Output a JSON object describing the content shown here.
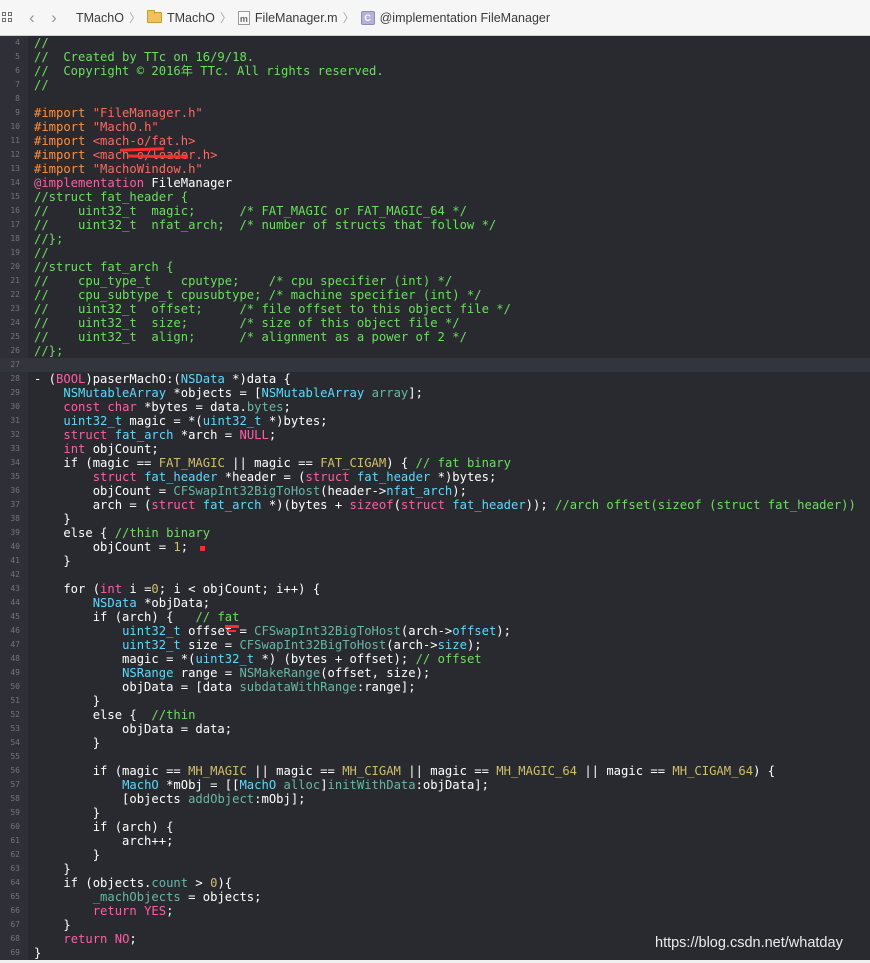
{
  "jumpbar": {
    "icons": [
      "grid-icon",
      "back-chevron-icon",
      "forward-chevron-icon",
      "folder-icon",
      "folder-icon",
      "file-m-icon",
      "implementation-c-icon"
    ],
    "back_glyph": "‹",
    "forward_glyph": "›",
    "crumbs": [
      {
        "label": "TMachO",
        "icon": "none"
      },
      {
        "label": "TMachO",
        "icon": "folder-icon"
      },
      {
        "label": "FileManager.m",
        "icon": "file-m-icon"
      },
      {
        "label": "@implementation FileManager",
        "icon": "implementation-c-icon"
      }
    ],
    "file_icon_letter": "m",
    "impl_icon_letter": "C"
  },
  "colors": {
    "background": "#292a30",
    "comment": "#6bdf5e",
    "preprocessor": "#fd8f3f",
    "string": "#fc6a5d",
    "keyword": "#fc5fa3",
    "type": "#5dd8ff",
    "function": "#67b7a4",
    "macro": "#d0bf69",
    "annotation": "#ff2a2a"
  },
  "code": {
    "current_line": 27,
    "lines": [
      {
        "n": "4",
        "segs": [
          [
            "c",
            "//"
          ]
        ]
      },
      {
        "n": "5",
        "segs": [
          [
            "c",
            "//  Created by TTc on 16/9/18."
          ]
        ]
      },
      {
        "n": "6",
        "segs": [
          [
            "c",
            "//  Copyright © 2016年 TTc. All rights reserved."
          ]
        ]
      },
      {
        "n": "7",
        "segs": [
          [
            "c",
            "//"
          ]
        ]
      },
      {
        "n": "8",
        "segs": []
      },
      {
        "n": "9",
        "segs": [
          [
            "pp",
            "#import "
          ],
          [
            "s",
            "\"FileManager.h\""
          ]
        ]
      },
      {
        "n": "10",
        "segs": [
          [
            "pp",
            "#import "
          ],
          [
            "s",
            "\"MachO.h\""
          ]
        ]
      },
      {
        "n": "11",
        "segs": [
          [
            "pp",
            "#import "
          ],
          [
            "s",
            "<mach-o/fat.h>"
          ]
        ]
      },
      {
        "n": "12",
        "segs": [
          [
            "pp",
            "#import "
          ],
          [
            "s",
            "<mach-o/loader.h>"
          ]
        ]
      },
      {
        "n": "13",
        "segs": [
          [
            "pp",
            "#import "
          ],
          [
            "s",
            "\"MachoWindow.h\""
          ]
        ]
      },
      {
        "n": "14",
        "segs": [
          [
            "k",
            "@implementation"
          ],
          [
            "p",
            " FileManager"
          ]
        ]
      },
      {
        "n": "15",
        "segs": [
          [
            "c",
            "//struct fat_header {"
          ]
        ]
      },
      {
        "n": "16",
        "segs": [
          [
            "c",
            "//    uint32_t  magic;      /* FAT_MAGIC or FAT_MAGIC_64 */"
          ]
        ]
      },
      {
        "n": "17",
        "segs": [
          [
            "c",
            "//    uint32_t  nfat_arch;  /* number of structs that follow */"
          ]
        ]
      },
      {
        "n": "18",
        "segs": [
          [
            "c",
            "//};"
          ]
        ]
      },
      {
        "n": "19",
        "segs": [
          [
            "c",
            "//"
          ]
        ]
      },
      {
        "n": "20",
        "segs": [
          [
            "c",
            "//struct fat_arch {"
          ]
        ]
      },
      {
        "n": "21",
        "segs": [
          [
            "c",
            "//    cpu_type_t    cputype;    /* cpu specifier (int) */"
          ]
        ]
      },
      {
        "n": "22",
        "segs": [
          [
            "c",
            "//    cpu_subtype_t cpusubtype; /* machine specifier (int) */"
          ]
        ]
      },
      {
        "n": "23",
        "segs": [
          [
            "c",
            "//    uint32_t  offset;     /* file offset to this object file */"
          ]
        ]
      },
      {
        "n": "24",
        "segs": [
          [
            "c",
            "//    uint32_t  size;       /* size of this object file */"
          ]
        ]
      },
      {
        "n": "25",
        "segs": [
          [
            "c",
            "//    uint32_t  align;      /* alignment as a power of 2 */"
          ]
        ]
      },
      {
        "n": "26",
        "segs": [
          [
            "c",
            "//};"
          ]
        ]
      },
      {
        "n": "27",
        "segs": []
      },
      {
        "n": "28",
        "segs": [
          [
            "p",
            "- ("
          ],
          [
            "k",
            "BOOL"
          ],
          [
            "p",
            ")paserMachO:("
          ],
          [
            "t",
            "NSData"
          ],
          [
            "p",
            " *)data {"
          ]
        ]
      },
      {
        "n": "29",
        "segs": [
          [
            "p",
            "    "
          ],
          [
            "t",
            "NSMutableArray"
          ],
          [
            "p",
            " *objects = ["
          ],
          [
            "t",
            "NSMutableArray"
          ],
          [
            "p",
            " "
          ],
          [
            "f",
            "array"
          ],
          [
            "p",
            "];"
          ]
        ]
      },
      {
        "n": "30",
        "segs": [
          [
            "p",
            "    "
          ],
          [
            "k",
            "const"
          ],
          [
            "p",
            " "
          ],
          [
            "k",
            "char"
          ],
          [
            "p",
            " *bytes = data."
          ],
          [
            "f",
            "bytes"
          ],
          [
            "p",
            ";"
          ]
        ]
      },
      {
        "n": "31",
        "segs": [
          [
            "p",
            "    "
          ],
          [
            "t",
            "uint32_t"
          ],
          [
            "p",
            " magic = *("
          ],
          [
            "t",
            "uint32_t"
          ],
          [
            "p",
            " *)bytes;"
          ]
        ]
      },
      {
        "n": "32",
        "segs": [
          [
            "p",
            "    "
          ],
          [
            "k",
            "struct"
          ],
          [
            "p",
            " "
          ],
          [
            "t",
            "fat_arch"
          ],
          [
            "p",
            " *arch = "
          ],
          [
            "k",
            "NULL"
          ],
          [
            "p",
            ";"
          ]
        ]
      },
      {
        "n": "33",
        "segs": [
          [
            "p",
            "    "
          ],
          [
            "k",
            "int"
          ],
          [
            "p",
            " objCount;"
          ]
        ]
      },
      {
        "n": "34",
        "segs": [
          [
            "p",
            "    if (magic == "
          ],
          [
            "m",
            "FAT_MAGIC"
          ],
          [
            "p",
            " || magic == "
          ],
          [
            "m",
            "FAT_CIGAM"
          ],
          [
            "p",
            ") { "
          ],
          [
            "c",
            "// fat binary"
          ]
        ]
      },
      {
        "n": "35",
        "segs": [
          [
            "p",
            "        "
          ],
          [
            "k",
            "struct"
          ],
          [
            "p",
            " "
          ],
          [
            "t",
            "fat_header"
          ],
          [
            "p",
            " *header = ("
          ],
          [
            "k",
            "struct"
          ],
          [
            "p",
            " "
          ],
          [
            "t",
            "fat_header"
          ],
          [
            "p",
            " *)bytes;"
          ]
        ]
      },
      {
        "n": "36",
        "segs": [
          [
            "p",
            "        objCount = "
          ],
          [
            "f",
            "CFSwapInt32BigToHost"
          ],
          [
            "p",
            "(header->"
          ],
          [
            "t",
            "nfat_arch"
          ],
          [
            "p",
            ");"
          ]
        ]
      },
      {
        "n": "37",
        "segs": [
          [
            "p",
            "        arch = ("
          ],
          [
            "k",
            "struct"
          ],
          [
            "p",
            " "
          ],
          [
            "t",
            "fat_arch"
          ],
          [
            "p",
            " *)(bytes + "
          ],
          [
            "k",
            "sizeof"
          ],
          [
            "p",
            "("
          ],
          [
            "k",
            "struct"
          ],
          [
            "p",
            " "
          ],
          [
            "t",
            "fat_header"
          ],
          [
            "p",
            "));"
          ],
          [
            "c",
            " //arch offset(sizeof (struct fat_header))"
          ]
        ]
      },
      {
        "n": "38",
        "segs": [
          [
            "p",
            "    }"
          ]
        ]
      },
      {
        "n": "39",
        "segs": [
          [
            "p",
            "    else { "
          ],
          [
            "c",
            "//thin binary"
          ]
        ]
      },
      {
        "n": "40",
        "segs": [
          [
            "p",
            "        objCount = "
          ],
          [
            "n",
            "1"
          ],
          [
            "p",
            ";"
          ]
        ]
      },
      {
        "n": "41",
        "segs": [
          [
            "p",
            "    }"
          ]
        ]
      },
      {
        "n": "42",
        "segs": []
      },
      {
        "n": "43",
        "segs": [
          [
            "p",
            "    for ("
          ],
          [
            "k",
            "int"
          ],
          [
            "p",
            " i ="
          ],
          [
            "n",
            "0"
          ],
          [
            "p",
            "; i < objCount; i++) {"
          ]
        ]
      },
      {
        "n": "44",
        "segs": [
          [
            "p",
            "        "
          ],
          [
            "t",
            "NSData"
          ],
          [
            "p",
            " *objData;"
          ]
        ]
      },
      {
        "n": "45",
        "segs": [
          [
            "p",
            "        if (arch) {   "
          ],
          [
            "c",
            "// fat"
          ]
        ]
      },
      {
        "n": "46",
        "segs": [
          [
            "p",
            "            "
          ],
          [
            "t",
            "uint32_t"
          ],
          [
            "p",
            " offset = "
          ],
          [
            "f",
            "CFSwapInt32BigToHost"
          ],
          [
            "p",
            "(arch->"
          ],
          [
            "t",
            "offset"
          ],
          [
            "p",
            ");"
          ]
        ]
      },
      {
        "n": "47",
        "segs": [
          [
            "p",
            "            "
          ],
          [
            "t",
            "uint32_t"
          ],
          [
            "p",
            " size = "
          ],
          [
            "f",
            "CFSwapInt32BigToHost"
          ],
          [
            "p",
            "(arch->"
          ],
          [
            "t",
            "size"
          ],
          [
            "p",
            ");"
          ]
        ]
      },
      {
        "n": "48",
        "segs": [
          [
            "p",
            "            magic = *("
          ],
          [
            "t",
            "uint32_t"
          ],
          [
            "p",
            " *) (bytes + offset); "
          ],
          [
            "c",
            "// offset"
          ]
        ]
      },
      {
        "n": "49",
        "segs": [
          [
            "p",
            "            "
          ],
          [
            "t",
            "NSRange"
          ],
          [
            "p",
            " range = "
          ],
          [
            "f",
            "NSMakeRange"
          ],
          [
            "p",
            "(offset, size);"
          ]
        ]
      },
      {
        "n": "50",
        "segs": [
          [
            "p",
            "            objData = [data "
          ],
          [
            "f",
            "subdataWithRange"
          ],
          [
            "p",
            ":range];"
          ]
        ]
      },
      {
        "n": "51",
        "segs": [
          [
            "p",
            "        }"
          ]
        ]
      },
      {
        "n": "52",
        "segs": [
          [
            "p",
            "        else {  "
          ],
          [
            "c",
            "//thin"
          ]
        ]
      },
      {
        "n": "53",
        "segs": [
          [
            "p",
            "            objData = data;"
          ]
        ]
      },
      {
        "n": "54",
        "segs": [
          [
            "p",
            "        }"
          ]
        ]
      },
      {
        "n": "55",
        "segs": []
      },
      {
        "n": "56",
        "segs": [
          [
            "p",
            "        if (magic == "
          ],
          [
            "m",
            "MH_MAGIC"
          ],
          [
            "p",
            " || magic == "
          ],
          [
            "m",
            "MH_CIGAM"
          ],
          [
            "p",
            " || magic == "
          ],
          [
            "m",
            "MH_MAGIC_64"
          ],
          [
            "p",
            " || magic == "
          ],
          [
            "m",
            "MH_CIGAM_64"
          ],
          [
            "p",
            ") {"
          ]
        ]
      },
      {
        "n": "57",
        "segs": [
          [
            "p",
            "            "
          ],
          [
            "t",
            "MachO"
          ],
          [
            "p",
            " *mObj = [["
          ],
          [
            "t",
            "MachO"
          ],
          [
            "p",
            " "
          ],
          [
            "f",
            "alloc"
          ],
          [
            "p",
            "]"
          ],
          [
            "f",
            "initWithData"
          ],
          [
            "p",
            ":objData];"
          ]
        ]
      },
      {
        "n": "58",
        "segs": [
          [
            "p",
            "            [objects "
          ],
          [
            "f",
            "addObject"
          ],
          [
            "p",
            ":mObj];"
          ]
        ]
      },
      {
        "n": "59",
        "segs": [
          [
            "p",
            "        }"
          ]
        ]
      },
      {
        "n": "60",
        "segs": [
          [
            "p",
            "        if (arch) {"
          ]
        ]
      },
      {
        "n": "61",
        "segs": [
          [
            "p",
            "            arch++;"
          ]
        ]
      },
      {
        "n": "62",
        "segs": [
          [
            "p",
            "        }"
          ]
        ]
      },
      {
        "n": "63",
        "segs": [
          [
            "p",
            "    }"
          ]
        ]
      },
      {
        "n": "64",
        "segs": [
          [
            "p",
            "    if (objects."
          ],
          [
            "f",
            "count"
          ],
          [
            "p",
            " > "
          ],
          [
            "n",
            "0"
          ],
          [
            "p",
            "){"
          ]
        ]
      },
      {
        "n": "65",
        "segs": [
          [
            "p",
            "        "
          ],
          [
            "f",
            "_machObjects"
          ],
          [
            "p",
            " = objects;"
          ]
        ]
      },
      {
        "n": "66",
        "segs": [
          [
            "p",
            "        "
          ],
          [
            "k",
            "return"
          ],
          [
            "p",
            " "
          ],
          [
            "k",
            "YES"
          ],
          [
            "p",
            ";"
          ]
        ]
      },
      {
        "n": "67",
        "segs": [
          [
            "p",
            "    }"
          ]
        ]
      },
      {
        "n": "68",
        "segs": [
          [
            "p",
            "    "
          ],
          [
            "k",
            "return"
          ],
          [
            "p",
            " "
          ],
          [
            "k",
            "NO"
          ],
          [
            "p",
            ";"
          ]
        ]
      },
      {
        "n": "69",
        "segs": [
          [
            "p",
            "}"
          ]
        ]
      }
    ]
  },
  "watermark": "https://blog.csdn.net/whatday"
}
